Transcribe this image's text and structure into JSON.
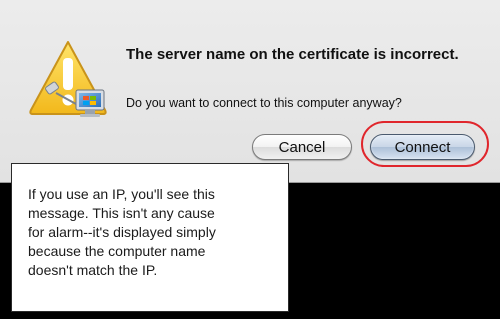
{
  "dialog": {
    "title": "The server name on the certificate is incorrect.",
    "message": "Do you want to connect to this computer anyway?",
    "icon": "warning-icon",
    "buttons": {
      "cancel_label": "Cancel",
      "connect_label": "Connect"
    }
  },
  "annotation": {
    "highlight_color": "#e0262c",
    "callout_text": "If you use an IP, you'll see this\nmessage. This isn't any cause\nfor alarm--it's displayed simply\nbecause the computer name\ndoesn't match the IP."
  },
  "colors": {
    "dialog_background": "#ececec",
    "page_background": "#000000",
    "default_button": "#c9d6e7"
  }
}
